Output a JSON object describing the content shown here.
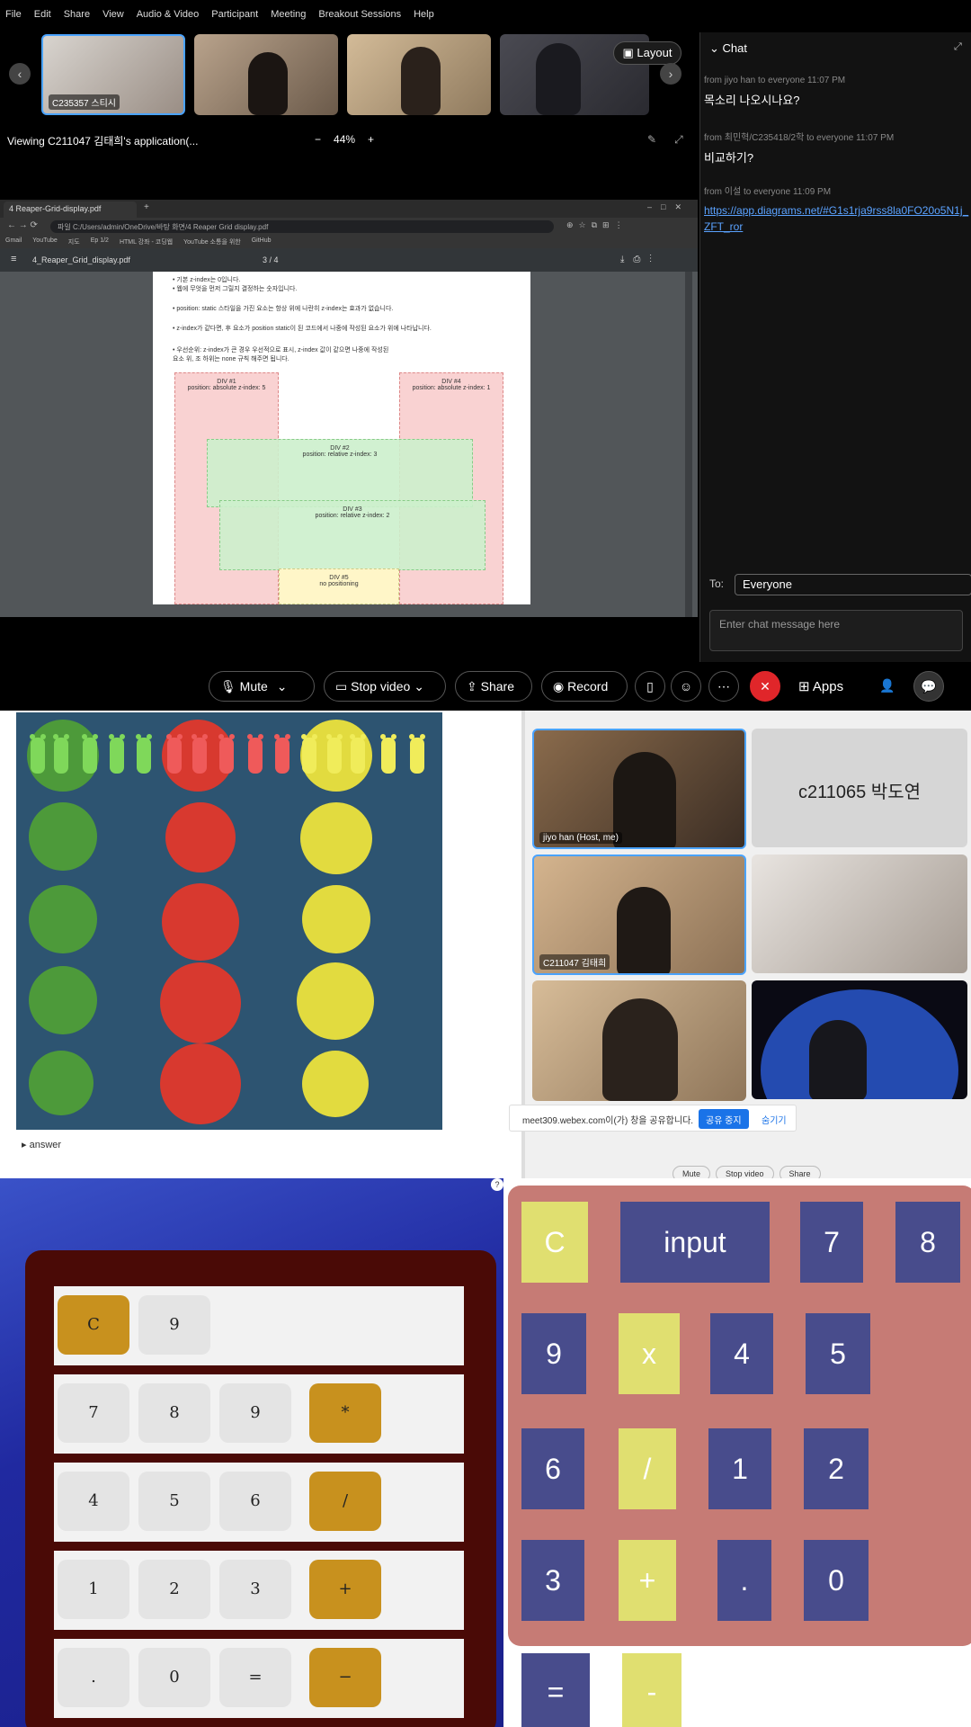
{
  "webex": {
    "menu": [
      "File",
      "Edit",
      "Share",
      "View",
      "Audio & Video",
      "Participant",
      "Meeting",
      "Breakout Sessions",
      "Help"
    ],
    "filmstrip": {
      "thumbs": [
        {
          "label": "C235357 스티시"
        },
        {
          "label": ""
        },
        {
          "label": ""
        },
        {
          "label": ""
        }
      ],
      "layout_label": "Layout"
    },
    "viewing": "Viewing C211047 김태희's application(...",
    "zoom": "44%",
    "browser": {
      "tab_title": "4 Reaper-Grid-display.pdf",
      "url": "파일 C:/Users/admin/OneDrive/바탕 화면/4 Reaper Grid display.pdf",
      "bookmarks": [
        "Gmail",
        "YouTube",
        "지도",
        "Ep 1/2",
        "HTML 강좌 - 코딩웹",
        "YouTube 소통을 위한",
        "GitHub"
      ],
      "pdf_name": "4_Reaper_Grid_display.pdf",
      "pdf_page": "3 / 4",
      "page_lines": [
        "• 기본 z-index는 0입니다.",
        "• 웹에 무엇을 먼저 그릴지 결정하는 숫자입니다.",
        "• position: static 스타일을 가진 요소는 항상 위에 나란히 z-index는 효과가 없습니다.",
        "• z-index가 같다면, 후 요소가 position static이 된 코드에서 나중에 작성된 요소가 위에 나타납니다.",
        "• 우선순위: z-index가 큰 경우 우선적으로 표시, z-index 값이 같으면 나중에 작성된",
        "  요소 위, 조 하위는 none 규칙 해주면 됩니다."
      ],
      "divs": [
        {
          "title": "DIV #1",
          "sub": "position: absolute z-index: 5"
        },
        {
          "title": "DIV #4",
          "sub": "position: absolute z-index: 1"
        },
        {
          "title": "DIV #2",
          "sub": "position: relative z-index: 3"
        },
        {
          "title": "DIV #3",
          "sub": "position: relative z-index: 2"
        },
        {
          "title": "DIV #5",
          "sub": "no positioning"
        }
      ]
    },
    "chat": {
      "title": "Chat",
      "messages": [
        {
          "meta": "from jiyo han to everyone    11:07 PM",
          "body": "목소리 나오시나요?"
        },
        {
          "meta": "from 최민혁/C235418/2학 to everyone    11:07 PM",
          "body": "비교하기?"
        },
        {
          "meta": "from 이설 to everyone    11:09 PM",
          "link": "https://app.diagrams.net/#G1s1rja9rss8la0FO20o5N1j_ZFT_ror"
        }
      ],
      "to_label": "To:",
      "to_value": "Everyone",
      "input_placeholder": "Enter chat message here"
    },
    "controls": {
      "mute": "Mute",
      "stop_video": "Stop video",
      "share": "Share",
      "record": "Record",
      "apps": "Apps"
    }
  },
  "frogs": {
    "answer_label": "answer"
  },
  "meet": {
    "tiles": [
      {
        "label": "jiyo han (Host, me)"
      },
      {
        "label": "c211065 박도연"
      },
      {
        "label": ""
      },
      {
        "label": "C211047 김태희"
      },
      {
        "label": ""
      },
      {
        "label": ""
      }
    ],
    "share_text": "meet309.webex.com이(가) 창을 공유합니다.",
    "stop_share": "공유 중지",
    "hide": "숨기기",
    "bottom_buttons": [
      "Mute",
      "Stop video",
      "Share"
    ]
  },
  "calc1": {
    "rows": [
      [
        "C",
        "9"
      ],
      [
        "7",
        "8",
        "9",
        "*"
      ],
      [
        "4",
        "5",
        "6",
        "/"
      ],
      [
        "1",
        "2",
        "3",
        "+"
      ],
      [
        ".",
        "0",
        "=",
        "−"
      ]
    ]
  },
  "calc2": {
    "keys": [
      "C",
      "input",
      "7",
      "8",
      "9",
      "x",
      "4",
      "5",
      "6",
      "/",
      "1",
      "2",
      "3",
      "+",
      ".",
      "0",
      "=",
      "-"
    ]
  },
  "colors": {
    "pond": "#2d5471",
    "green": "#4d9a3a",
    "red": "#d8392f",
    "yellow": "#e2db3f",
    "calc1_op": "#c8911e",
    "calc2_bg": "#c67b75",
    "calc2_blue": "#484c8c",
    "calc2_yellow": "#e0df70"
  }
}
